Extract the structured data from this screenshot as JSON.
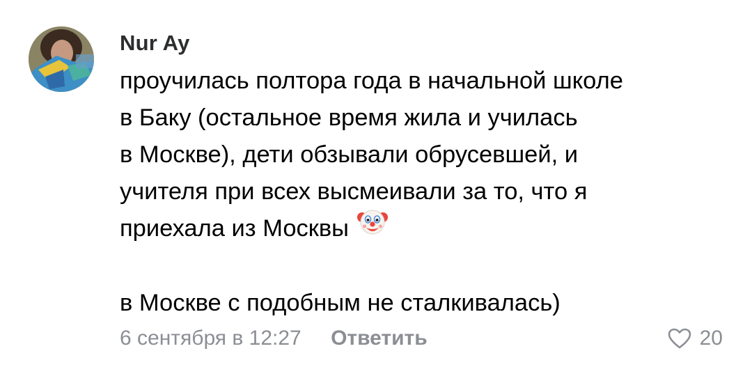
{
  "comment": {
    "author": "Nur Ay",
    "lines": [
      "проучилась полтора года в начальной школе",
      "в Баку (остальное время жила и училась",
      "в Москве), дети обзывали обрусевшей, и",
      "учителя при всех высмеивали за то, что я",
      "приехала из Москвы"
    ],
    "emoji": "clown-face-icon",
    "last_line": "в Москве с подобным не сталкивалась)",
    "date": "6 сентября в 12:27",
    "reply_label": "Ответить",
    "likes": "20"
  },
  "colors": {
    "text": "#000000",
    "author": "#2c2d2e",
    "meta": "#8b8e93"
  }
}
